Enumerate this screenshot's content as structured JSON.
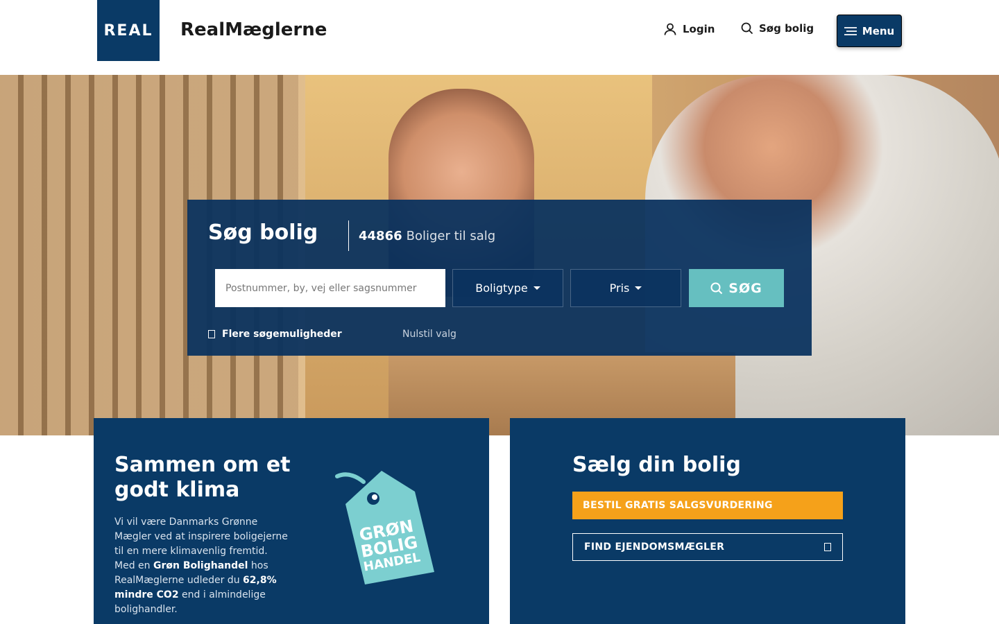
{
  "header": {
    "logo_text": "REAL",
    "brand": "RealMæglerne",
    "login_label": "Login",
    "search_label": "Søg bolig",
    "menu_label": "Menu"
  },
  "search": {
    "title": "Søg bolig",
    "count": "44866",
    "count_label": "Boliger til salg",
    "placeholder": "Postnummer, by, vej eller sagsnummer",
    "type_label": "Boligtype",
    "price_label": "Pris",
    "search_button": "SØG",
    "more_options": "Flere søgemuligheder",
    "reset": "Nulstil valg"
  },
  "climate_card": {
    "title": "Sammen om et godt klima",
    "text_1": "Vi vil være Danmarks Grønne Mægler ved at inspirere boligejerne til en mere klimavenlig fremtid. Med en ",
    "bold_1": "Grøn Bolighandel",
    "text_2": " hos RealMæglerne udleder du ",
    "bold_2": "62,8% mindre CO2",
    "text_3": " end i almindelige bolighandler.",
    "tag_line_1": "GRØN",
    "tag_line_2": "BOLIG",
    "tag_line_3": "HANDEL"
  },
  "sell_card": {
    "title": "Sælg din bolig",
    "primary_button": "BESTIL GRATIS SALGSVURDERING",
    "secondary_button": "FIND EJENDOMSMÆGLER"
  },
  "colors": {
    "navy": "#0a3a66",
    "teal": "#66bfc0",
    "yellow": "#f5a11a",
    "tag_teal": "#7ccfd0"
  }
}
